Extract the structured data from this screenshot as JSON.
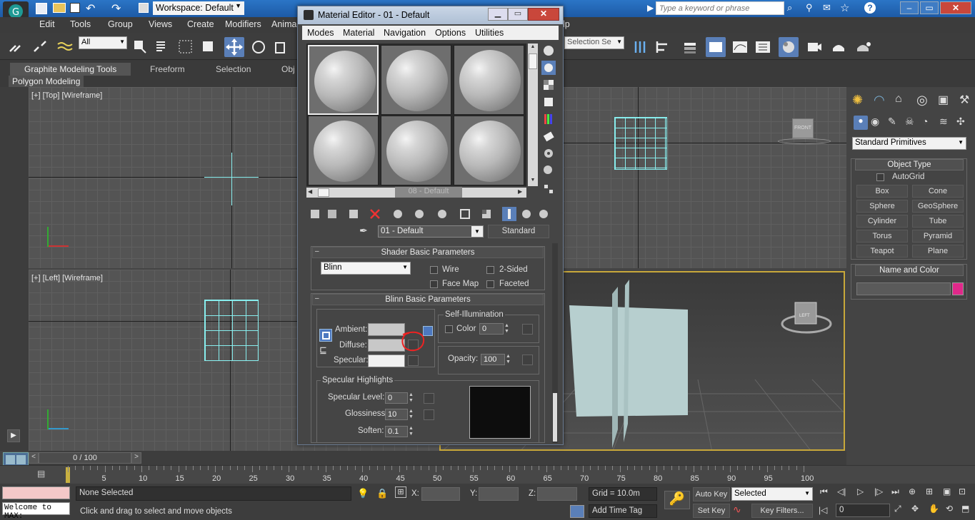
{
  "app": {
    "workspace_label": "Workspace: Default",
    "search_placeholder": "Type a keyword or phrase"
  },
  "menu": [
    "Edit",
    "Tools",
    "Group",
    "Views",
    "Create",
    "Modifiers",
    "Anima",
    "lp"
  ],
  "toolbar": {
    "filter_value": "All",
    "selection_set_value": "Selection Se"
  },
  "ribbon": {
    "tabs": [
      "Graphite Modeling Tools",
      "Freeform",
      "Selection",
      "Obj"
    ],
    "sub_label": "Polygon Modeling"
  },
  "viewports": {
    "top_label": "[+] [Top] [Wireframe]",
    "left_label": "[+] [Left] [Wireframe]",
    "viewcube_top": "FRONT",
    "viewcube_persp": "LEFT"
  },
  "command_panel": {
    "category_dropdown": "Standard Primitives",
    "object_type_title": "Object Type",
    "autogrid_label": "AutoGrid",
    "buttons": [
      "Box",
      "Cone",
      "Sphere",
      "GeoSphere",
      "Cylinder",
      "Tube",
      "Torus",
      "Pyramid",
      "Teapot",
      "Plane"
    ],
    "name_color_title": "Name and Color",
    "object_color": "#e0288a"
  },
  "timeline": {
    "frame_display": "0 / 100",
    "ticks": [
      "5",
      "10",
      "15",
      "20",
      "25",
      "30",
      "35",
      "40",
      "45",
      "50",
      "55",
      "60",
      "65",
      "70",
      "75",
      "80",
      "85",
      "90",
      "95",
      "100"
    ]
  },
  "status": {
    "maxscript_text": "Welcome to MAX:",
    "selection_text": "None Selected",
    "prompt_text": "Click and drag to select and move objects",
    "x_label": "X:",
    "y_label": "Y:",
    "z_label": "Z:",
    "grid_text": "Grid = 10.0m",
    "add_time_tag": "Add Time Tag",
    "auto_key": "Auto Key",
    "set_key": "Set Key",
    "key_mode_value": "Selected",
    "key_filters": "Key Filters...",
    "frame_value": "0"
  },
  "material_editor": {
    "title": "Material Editor - 01 - Default",
    "menu": [
      "Modes",
      "Material",
      "Navigation",
      "Options",
      "Utilities"
    ],
    "hidden_slot_name": "08 - Default",
    "material_name": "01 - Default",
    "material_type": "Standard",
    "shader_panel_title": "Shader Basic Parameters",
    "shader_value": "Blinn",
    "wire_label": "Wire",
    "two_sided_label": "2-Sided",
    "face_map_label": "Face Map",
    "faceted_label": "Faceted",
    "blinn_panel_title": "Blinn Basic Parameters",
    "self_illum_title": "Self-Illumination",
    "ambient_label": "Ambient:",
    "diffuse_label": "Diffuse:",
    "specular_label": "Specular:",
    "color_label": "Color",
    "color_value": "0",
    "opacity_label": "Opacity:",
    "opacity_value": "100",
    "spec_highlights_title": "Specular Highlights",
    "specular_level_label": "Specular Level:",
    "specular_level_value": "0",
    "glossiness_label": "Glossiness:",
    "glossiness_value": "10",
    "soften_label": "Soften:",
    "soften_value": "0.1"
  }
}
